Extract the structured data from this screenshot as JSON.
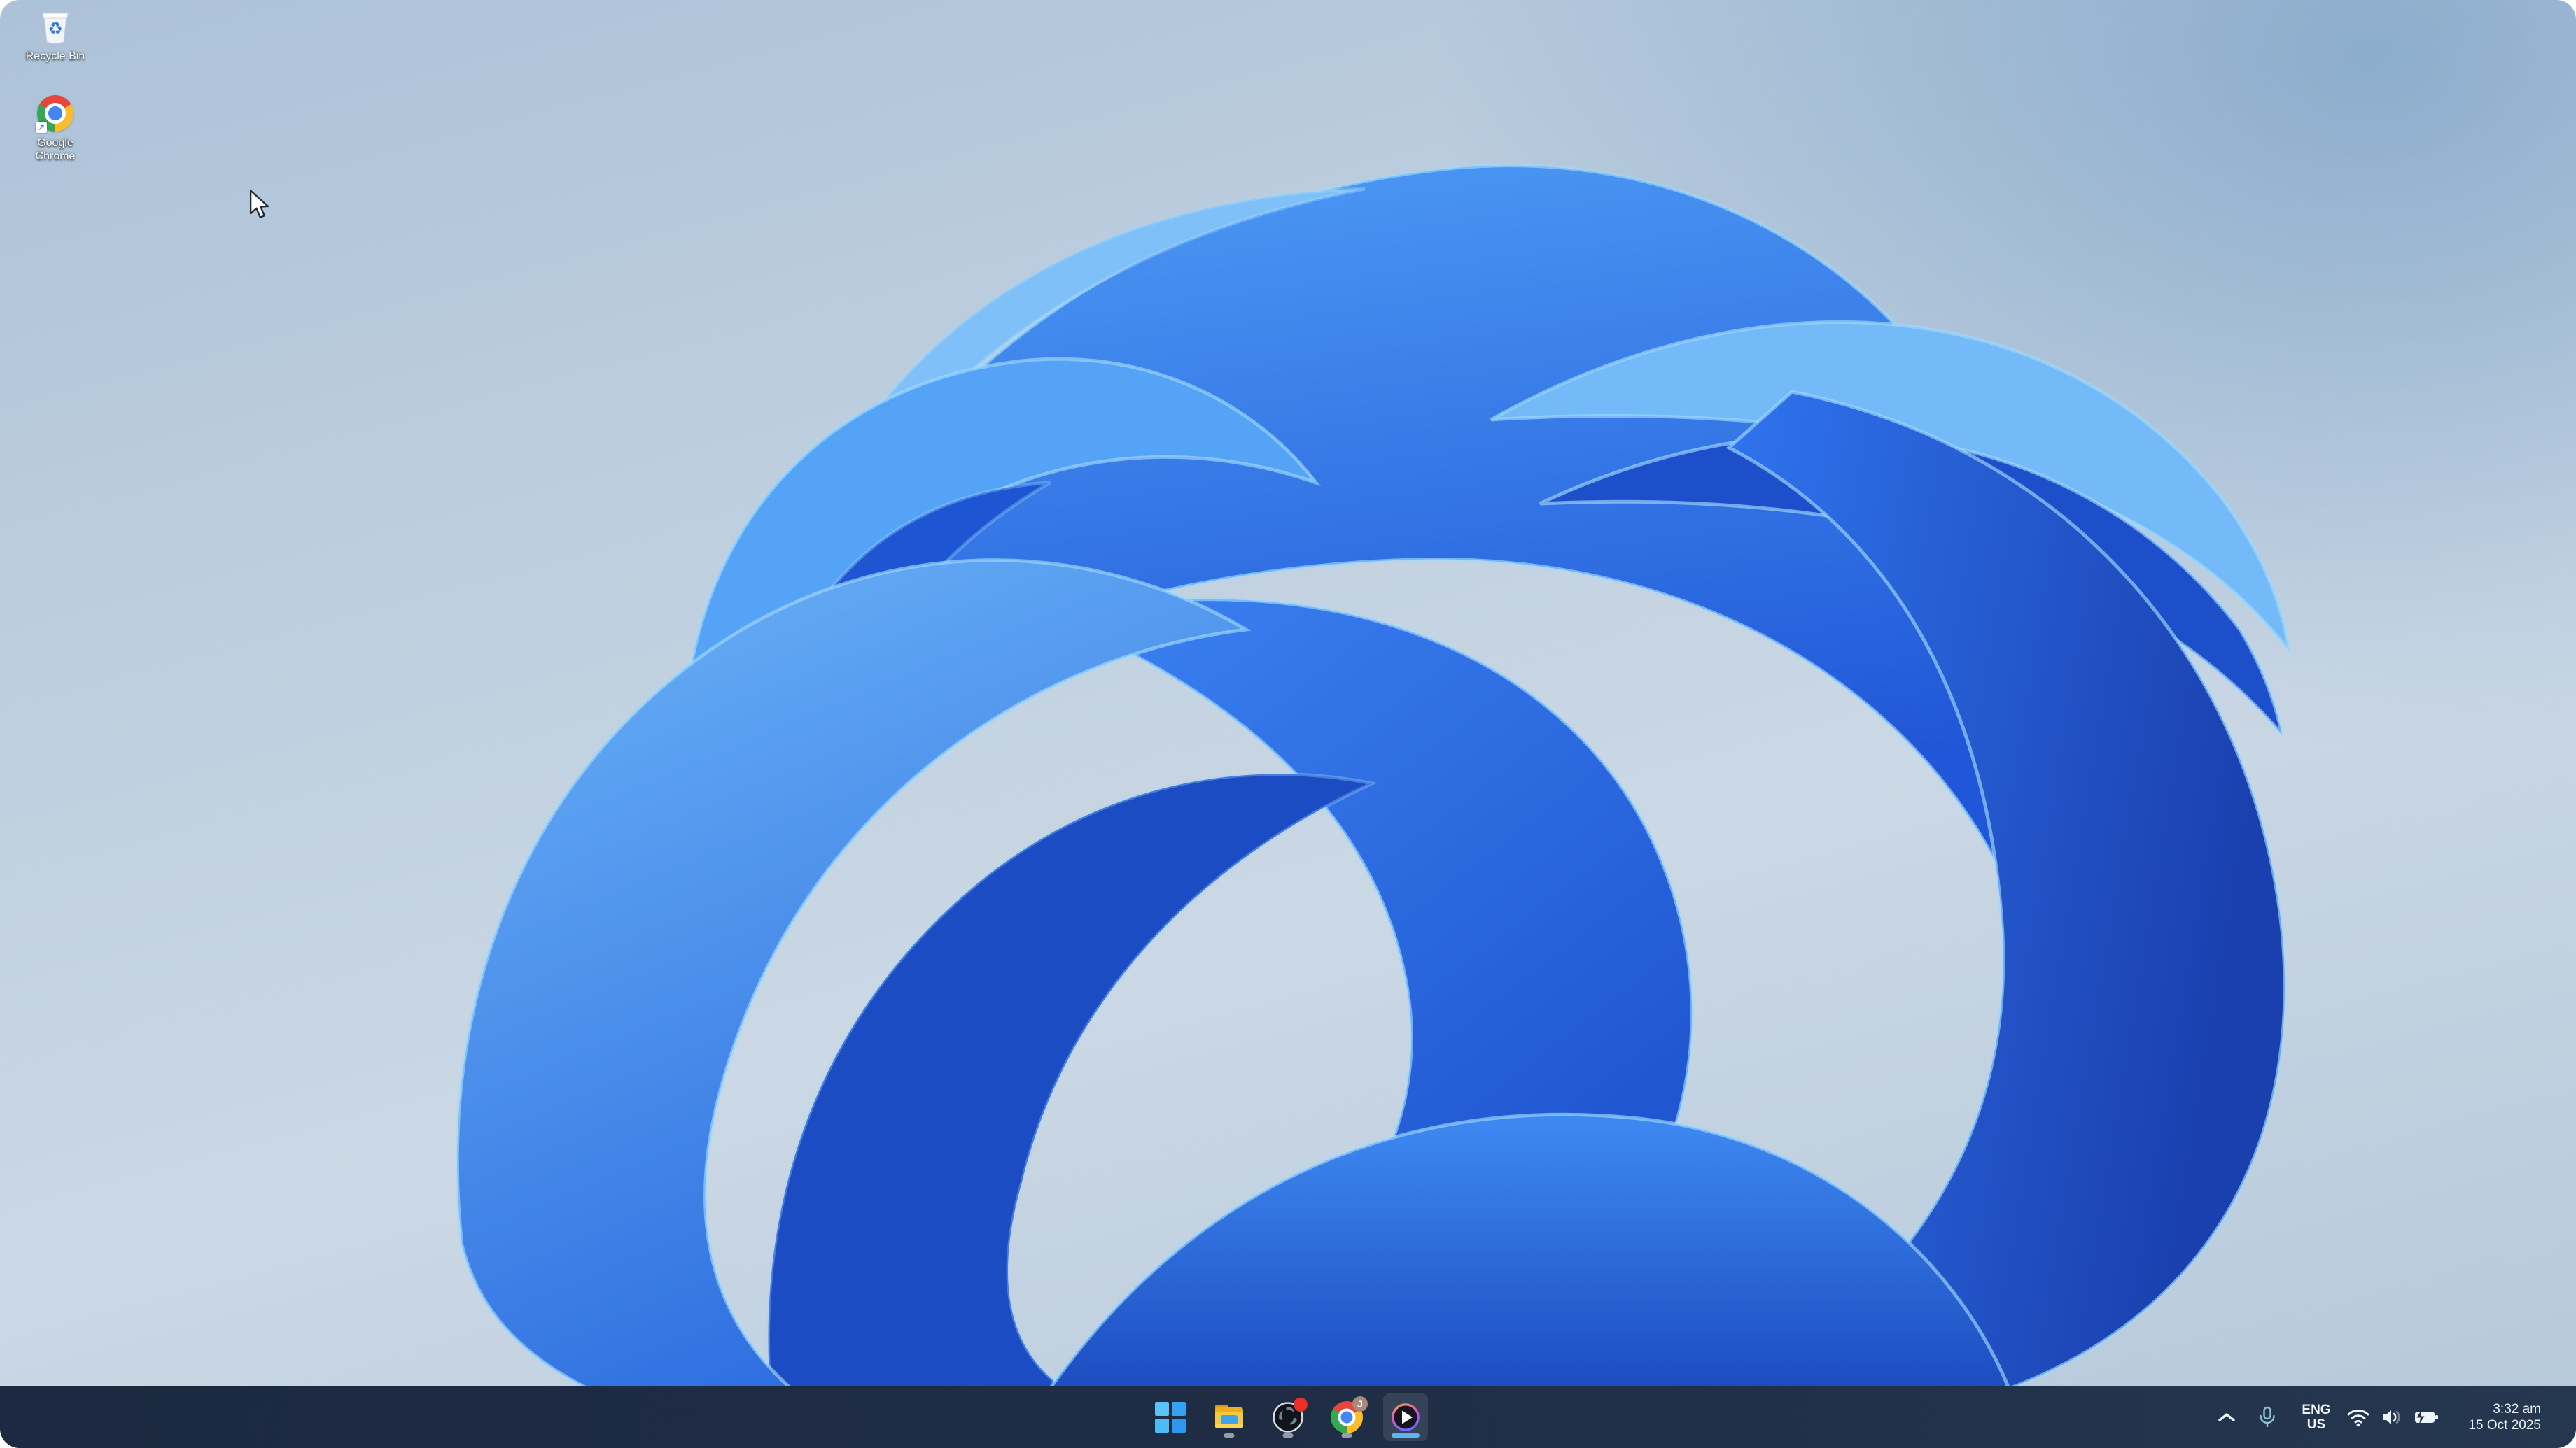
{
  "desktop": {
    "icons": [
      {
        "name": "recycle-bin",
        "label": "Recycle Bin"
      },
      {
        "name": "google-chrome",
        "label": "Google\nChrome"
      }
    ],
    "wallpaper": "windows-11-bloom",
    "wallpaper_accent": "#2e6fe8"
  },
  "taskbar": {
    "color": "#1f2d45",
    "apps": [
      {
        "icon": "windows-start-icon",
        "running": false,
        "active": false
      },
      {
        "icon": "file-explorer-icon",
        "running": true,
        "active": false
      },
      {
        "icon": "obs-studio-icon",
        "running": true,
        "active": false,
        "badge": "recording-dot",
        "badge_color": "#e92f28"
      },
      {
        "icon": "chrome-icon",
        "running": true,
        "active": false,
        "badge_letter": "J"
      },
      {
        "icon": "media-player-icon",
        "running": true,
        "active": true
      }
    ],
    "indicator_colors": {
      "running_pill": "#939dae",
      "focused_pill": "#5ab6f2"
    },
    "tray": {
      "chevron": "hidden-icons",
      "microphone_in_use": true,
      "language": {
        "line1": "ENG",
        "line2": "US"
      },
      "icons": [
        "wifi-icon",
        "volume-icon",
        "battery-charging-icon"
      ],
      "clock": {
        "time": "3:32 am",
        "date": "15 Oct 2025"
      }
    }
  }
}
